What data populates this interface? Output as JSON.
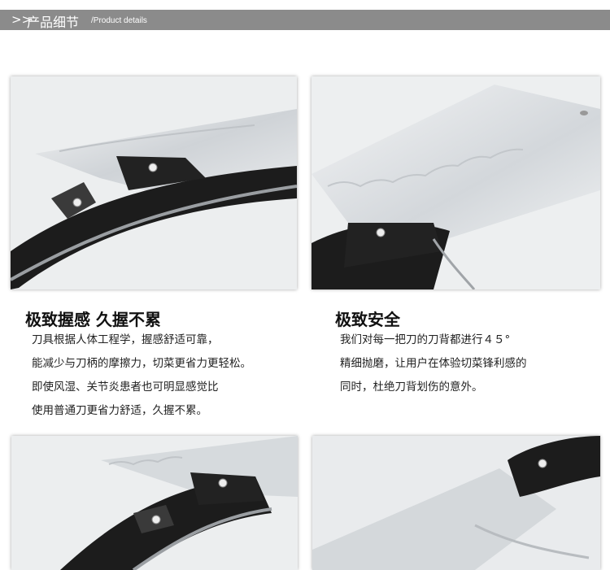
{
  "header": {
    "prefix": ">>",
    "title_cn": "产品细节",
    "title_en": "/Product details"
  },
  "sections": [
    {
      "heading": "极致握感 久握不累",
      "lines": [
        "刀具根据人体工程学，握感舒适可靠，",
        "能减少与刀柄的摩擦力，切菜更省力更轻松。",
        "即使风湿、关节炎患者也可明显感觉比",
        "使用普通刀更省力舒适，久握不累。"
      ]
    },
    {
      "heading": "极致安全",
      "lines": [
        "我们对每一把刀的刀背都进行４５°",
        "精细抛磨，让用户在体验切菜锋利感的",
        "同时，杜绝刀背划伤的意外。"
      ]
    }
  ],
  "colors": {
    "header_bar": "#8b8b8b",
    "handle": "#1a1a1a",
    "blade": "#d4d8dc"
  }
}
